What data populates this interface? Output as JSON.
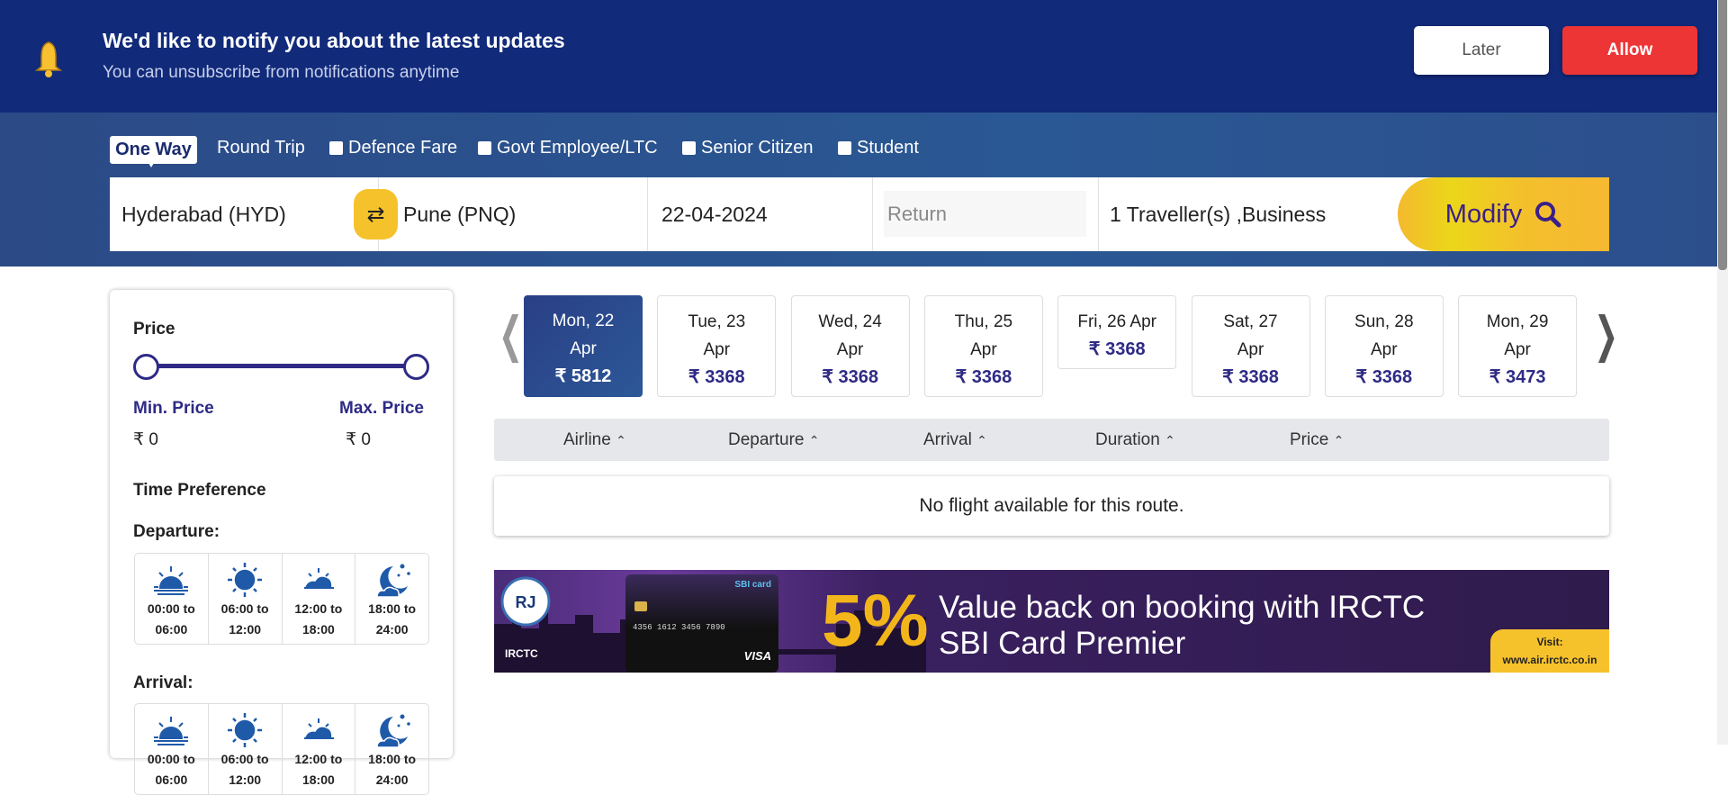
{
  "notification": {
    "title": "We'd like to notify you about the latest updates",
    "subtitle": "You can unsubscribe from notifications anytime",
    "later_label": "Later",
    "allow_label": "Allow"
  },
  "search": {
    "trip_types": [
      "One Way",
      "Round Trip"
    ],
    "selected_trip": "One Way",
    "options": [
      "Defence Fare",
      "Govt Employee/LTC",
      "Senior Citizen",
      "Student"
    ],
    "from": "Hyderabad (HYD)",
    "to": "Pune (PNQ)",
    "depart_date": "22-04-2024",
    "return_placeholder": "Return",
    "travellers": "1  Traveller(s) ,Business",
    "modify_label": "Modify"
  },
  "filters": {
    "price_title": "Price",
    "min_label": "Min. Price",
    "max_label": "Max. Price",
    "min_value": "₹ 0",
    "max_value": "₹ 0",
    "time_pref_title": "Time Preference",
    "departure_label": "Departure:",
    "arrival_label": "Arrival:",
    "slots": [
      {
        "l1": "00:00 to",
        "l2": "06:00",
        "icon": "sunrise-icon"
      },
      {
        "l1": "06:00 to",
        "l2": "12:00",
        "icon": "sun-icon"
      },
      {
        "l1": "12:00 to",
        "l2": "18:00",
        "icon": "sunset-icon"
      },
      {
        "l1": "18:00 to",
        "l2": "24:00",
        "icon": "moon-icon"
      }
    ]
  },
  "dates": [
    {
      "l1": "Mon, 22",
      "l2": "Apr",
      "price": "₹ 5812",
      "selected": true
    },
    {
      "l1": "Tue, 23",
      "l2": "Apr",
      "price": "₹ 3368"
    },
    {
      "l1": "Wed, 24",
      "l2": "Apr",
      "price": "₹ 3368"
    },
    {
      "l1": "Thu, 25",
      "l2": "Apr",
      "price": "₹ 3368"
    },
    {
      "l1": "Fri, 26 Apr",
      "l2": "",
      "price": "₹ 3368"
    },
    {
      "l1": "Sat, 27",
      "l2": "Apr",
      "price": "₹ 3368"
    },
    {
      "l1": "Sun, 28",
      "l2": "Apr",
      "price": "₹ 3368"
    },
    {
      "l1": "Mon, 29",
      "l2": "Apr",
      "price": "₹ 3473"
    }
  ],
  "sort": [
    "Airline",
    "Departure",
    "Arrival",
    "Duration",
    "Price"
  ],
  "results": {
    "empty_message": "No flight available for this route."
  },
  "banner": {
    "percent": "5%",
    "line1": "Value back on booking with IRCTC",
    "line2": "SBI Card Premier",
    "visit": "Visit:",
    "url": "www.air.irctc.co.in",
    "logo_text": "IRCTC",
    "card_brand": "SBI card",
    "card_number": "4356 1612 3456 7890",
    "card_network": "VISA"
  },
  "colors": {
    "notif_bg": "#112a7a",
    "allow": "#ee3535",
    "accent": "#2e2a85",
    "modify": "#f4c22c"
  }
}
